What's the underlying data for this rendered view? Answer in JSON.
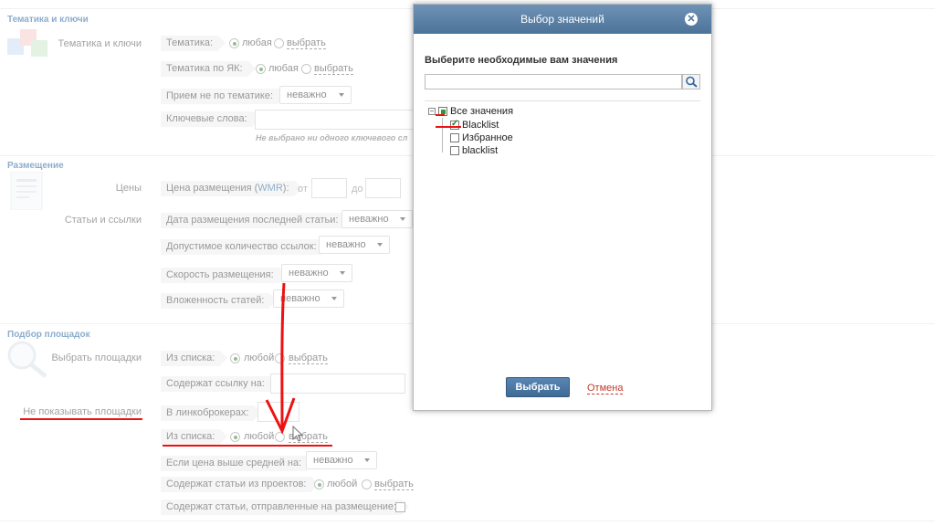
{
  "sections": {
    "topics": {
      "title": "Тематика и ключи",
      "group_label": "Тематика и ключи",
      "topic": {
        "label": "Тематика:",
        "opt_any": "любая",
        "opt_choose": "выбрать"
      },
      "yak_topic": {
        "label": "Тематика по ЯК:",
        "opt_any": "любая",
        "opt_choose": "выбрать"
      },
      "off_topic": {
        "label": "Прием не по тематике:",
        "value": "неважно"
      },
      "keywords": {
        "label": "Ключевые слова:",
        "hint": "Не выбрано ни одного ключевого сл"
      }
    },
    "placement": {
      "title": "Размещение",
      "prices_label": "Цены",
      "price": {
        "label_prefix": "Цена размещения (",
        "label_unit": "WMR",
        "label_suffix": "):",
        "from": "от",
        "to": "до"
      },
      "articles_label": "Статьи и ссылки",
      "last_article_date": {
        "label": "Дата размещения последней статьи:",
        "value": "неважно"
      },
      "links_count": {
        "label": "Допустимое количество ссылок:",
        "value": "неважно"
      },
      "speed": {
        "label": "Скорость размещения:",
        "value": "неважно"
      },
      "nesting": {
        "label": "Вложенность статей:",
        "value": "неважно"
      }
    },
    "sites": {
      "title": "Подбор площадок",
      "choose_label": "Выбрать площадки",
      "from_list": {
        "label": "Из списка:",
        "opt_any": "любой",
        "opt_choose": "выбрать"
      },
      "contains_link": {
        "label": "Содержат ссылку на:"
      },
      "hide_label": "Не показывать площадки",
      "in_brokers": {
        "label": "В линкоброкерах:"
      },
      "hide_from_list": {
        "label": "Из списка:",
        "opt_any": "любой",
        "opt_choose": "выбрать"
      },
      "price_above_avg": {
        "label": "Если цена выше средней на:",
        "value": "неважно"
      },
      "project_articles": {
        "label": "Содержат статьи из проектов:",
        "opt_any": "любой",
        "opt_choose": "выбрать"
      },
      "sent_articles": {
        "label": "Содержат статьи, отправленные на размещение:"
      }
    }
  },
  "modal": {
    "title": "Выбор значений",
    "subtitle": "Выберите необходимые вам значения",
    "search_placeholder": "",
    "tree": {
      "root": "Все значения",
      "items": [
        {
          "label": "Blacklist",
          "checked": true
        },
        {
          "label": "Избранное",
          "checked": false
        },
        {
          "label": "blacklist",
          "checked": false
        }
      ]
    },
    "select_button": "Выбрать",
    "cancel_link": "Отмена"
  },
  "colors": {
    "section_title": "#2f6aa3",
    "modal_header": "#5a80a6",
    "annotation_red": "#ee1111",
    "radio_selected": "#3a8a3a"
  }
}
